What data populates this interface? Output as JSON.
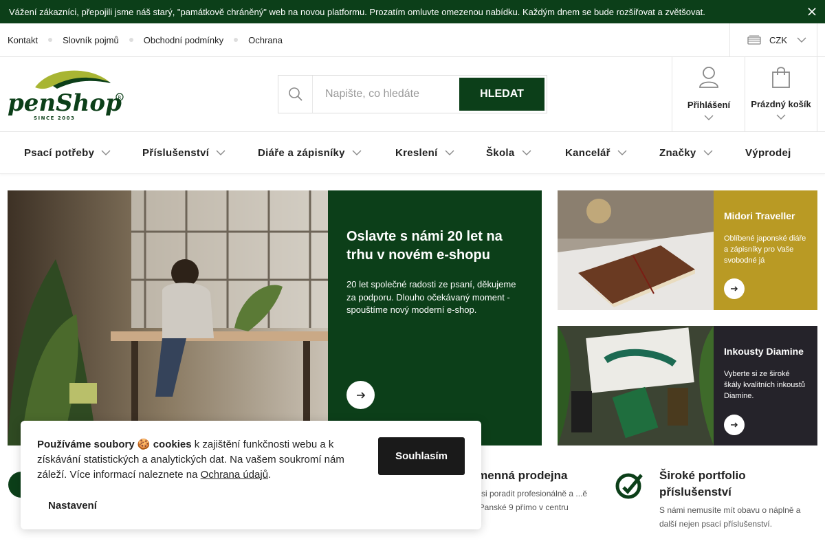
{
  "notice": {
    "text": "Vážení zákazníci, přepojili jsme náš starý, \"památkově chráněný\" web na novou platformu. Prozatím omluvte omezenou nabídku. Každým dnem se bude rozšiřovat a zvětšovat."
  },
  "toplinks": [
    "Kontakt",
    "Slovník pojmů",
    "Obchodní podmínky",
    "Ochrana"
  ],
  "currency": {
    "value": "CZK"
  },
  "logo": {
    "text": "penShop",
    "sub": "SINCE 2003"
  },
  "search": {
    "placeholder": "Napište, co hledáte",
    "button": "HLEDAT"
  },
  "account": {
    "label": "Přihlášení"
  },
  "cart": {
    "label": "Prázdný košík"
  },
  "nav": [
    "Psací potřeby",
    "Příslušenství",
    "Diáře a zápisníky",
    "Kreslení",
    "Škola",
    "Kancelář",
    "Značky",
    "Výprodej"
  ],
  "hero": {
    "title": "Oslavte s námi 20 let na trhu v novém e-shopu",
    "text": "20 let společné radosti ze psaní, děkujeme za podporu. Dlouho očekávaný moment - spouštíme nový moderní e-shop."
  },
  "promos": [
    {
      "title": "Midori Traveller",
      "text": "Oblíbené japonské diáře a zápisníky pro Vaše svobodné já",
      "color": "#b99a24"
    },
    {
      "title": "Inkousty Diamine",
      "text": "Vyberte si ze široké škály kvalitních inkoustů Diamine.",
      "color": "#25232a"
    }
  ],
  "features": [
    {
      "title": "...menná prodejna",
      "text": "...e si poradit profesionálně a ...ě na Panské 9 přímo v centru"
    },
    {
      "title": "Široké portfolio příslušenství",
      "text": "S námi nemusíte mít obavu o náplně a další nejen psací příslušenství."
    }
  ],
  "cookie": {
    "bold": "Používáme soubory 🍪 cookies",
    "text": " k zajištění funkčnosti webu a k získávání statistických a analytických dat. Na vašem soukromí nám záleží. Více informací naleznete na ",
    "link": "Ochrana údajů",
    "end": ".",
    "agree": "Souhlasím",
    "settings": "Nastavení"
  },
  "colors": {
    "brand_green": "#0c3f19",
    "gold": "#b99a24",
    "dark": "#25232a"
  }
}
